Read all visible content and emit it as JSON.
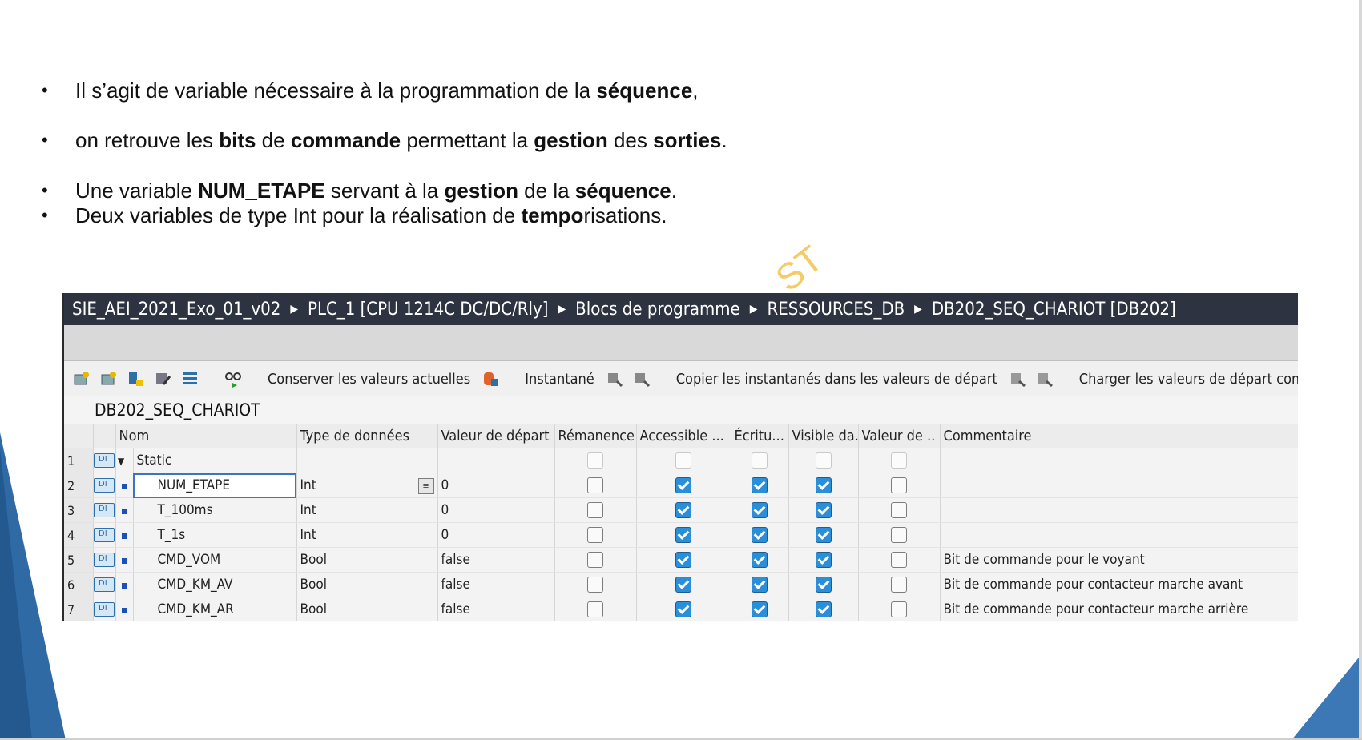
{
  "bullets": [
    {
      "parts": [
        {
          "t": "Il s’agit de variable nécessaire à la programmation de la "
        },
        {
          "t": "séquence",
          "b": true
        },
        {
          "t": ","
        }
      ]
    },
    {
      "parts": [
        {
          "t": "on retrouve les "
        },
        {
          "t": "bits",
          "b": true
        },
        {
          "t": " de "
        },
        {
          "t": "commande",
          "b": true
        },
        {
          "t": " permettant la "
        },
        {
          "t": "gestion",
          "b": true
        },
        {
          "t": " des "
        },
        {
          "t": "sorties",
          "b": true
        },
        {
          "t": "."
        }
      ]
    },
    {
      "parts": [
        {
          "t": "Une variable "
        },
        {
          "t": "NUM_ETAPE",
          "b": true
        },
        {
          "t": " servant à la "
        },
        {
          "t": "gestion",
          "b": true
        },
        {
          "t": " de la "
        },
        {
          "t": "séquence",
          "b": true
        },
        {
          "t": "."
        }
      ]
    },
    {
      "parts": [
        {
          "t": "Deux variables de type Int pour la réalisation de "
        },
        {
          "t": "tempo",
          "b": true
        },
        {
          "t": "risations."
        }
      ]
    }
  ],
  "watermark": "ST",
  "breadcrumb": [
    "SIE_AEI_2021_Exo_01_v02",
    "PLC_1 [CPU 1214C DC/DC/Rly]",
    "Blocs de programme",
    "RESSOURCES_DB",
    "DB202_SEQ_CHARIOT [DB202]"
  ],
  "toolbar": {
    "keep_values": "Conserver les valeurs actuelles",
    "snapshot": "Instantané",
    "copy_snapshots": "Copier les instantanés dans les valeurs de départ",
    "load_start": "Charger les valeurs de départ comme v"
  },
  "db_name": "DB202_SEQ_CHARIOT",
  "columns": [
    "Nom",
    "Type de données",
    "Valeur de départ",
    "Rémanence",
    "Accessible ...",
    "Écritu...",
    "Visible da...",
    "Valeur de ..",
    "Commentaire"
  ],
  "rows": [
    {
      "num": "1",
      "name": "Static",
      "type": "",
      "start": "",
      "retain": false,
      "access": false,
      "write": false,
      "visible": false,
      "setpoint": false,
      "comment": "",
      "header": true
    },
    {
      "num": "2",
      "name": "NUM_ETAPE",
      "type": "Int",
      "start": "0",
      "retain": false,
      "access": true,
      "write": true,
      "visible": true,
      "setpoint": false,
      "comment": ""
    },
    {
      "num": "3",
      "name": "T_100ms",
      "type": "Int",
      "start": "0",
      "retain": false,
      "access": true,
      "write": true,
      "visible": true,
      "setpoint": false,
      "comment": ""
    },
    {
      "num": "4",
      "name": "T_1s",
      "type": "Int",
      "start": "0",
      "retain": false,
      "access": true,
      "write": true,
      "visible": true,
      "setpoint": false,
      "comment": ""
    },
    {
      "num": "5",
      "name": "CMD_VOM",
      "type": "Bool",
      "start": "false",
      "retain": false,
      "access": true,
      "write": true,
      "visible": true,
      "setpoint": false,
      "comment": "Bit de commande pour le voyant"
    },
    {
      "num": "6",
      "name": "CMD_KM_AV",
      "type": "Bool",
      "start": "false",
      "retain": false,
      "access": true,
      "write": true,
      "visible": true,
      "setpoint": false,
      "comment": "Bit de commande pour contacteur marche avant"
    },
    {
      "num": "7",
      "name": "CMD_KM_AR",
      "type": "Bool",
      "start": "false",
      "retain": false,
      "access": true,
      "write": true,
      "visible": true,
      "setpoint": false,
      "comment": "Bit de commande pour contacteur marche arrière"
    }
  ],
  "colors": {
    "accent": "#2f6aa5",
    "titlebar": "#2d3340",
    "checkbox": "#2a8fd8"
  }
}
